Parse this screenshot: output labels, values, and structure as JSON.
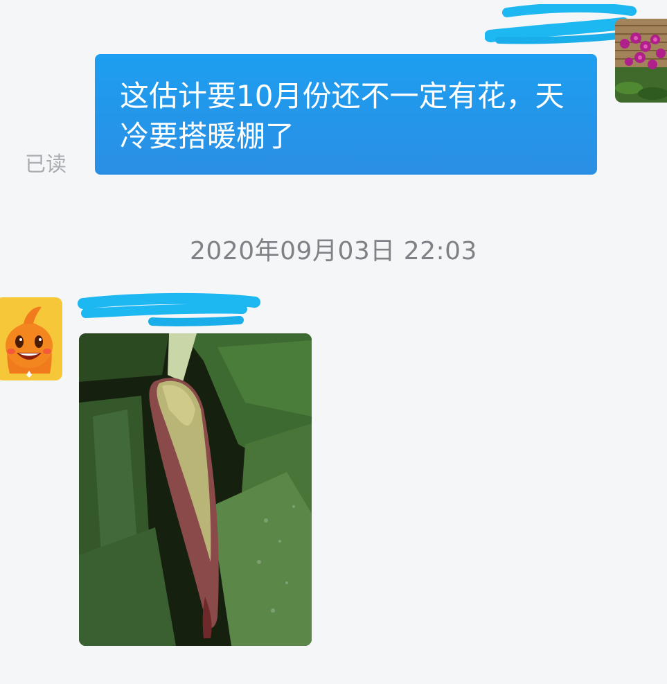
{
  "conversation": {
    "messages": [
      {
        "sender": "self",
        "text": "这估计要10月份还不一定有花，天冷要搭暖棚了",
        "read_status": "已读"
      },
      {
        "sender": "other",
        "type": "image"
      }
    ],
    "timestamp": "2020年09月03日 22:03"
  },
  "colors": {
    "background": "#f5f6f8",
    "bubble_self": "#1d9ef0",
    "redaction": "#1fb6f0"
  },
  "icons": {
    "self_avatar": "orchid-photo-avatar",
    "other_avatar": "orange-cartoon-avatar"
  }
}
